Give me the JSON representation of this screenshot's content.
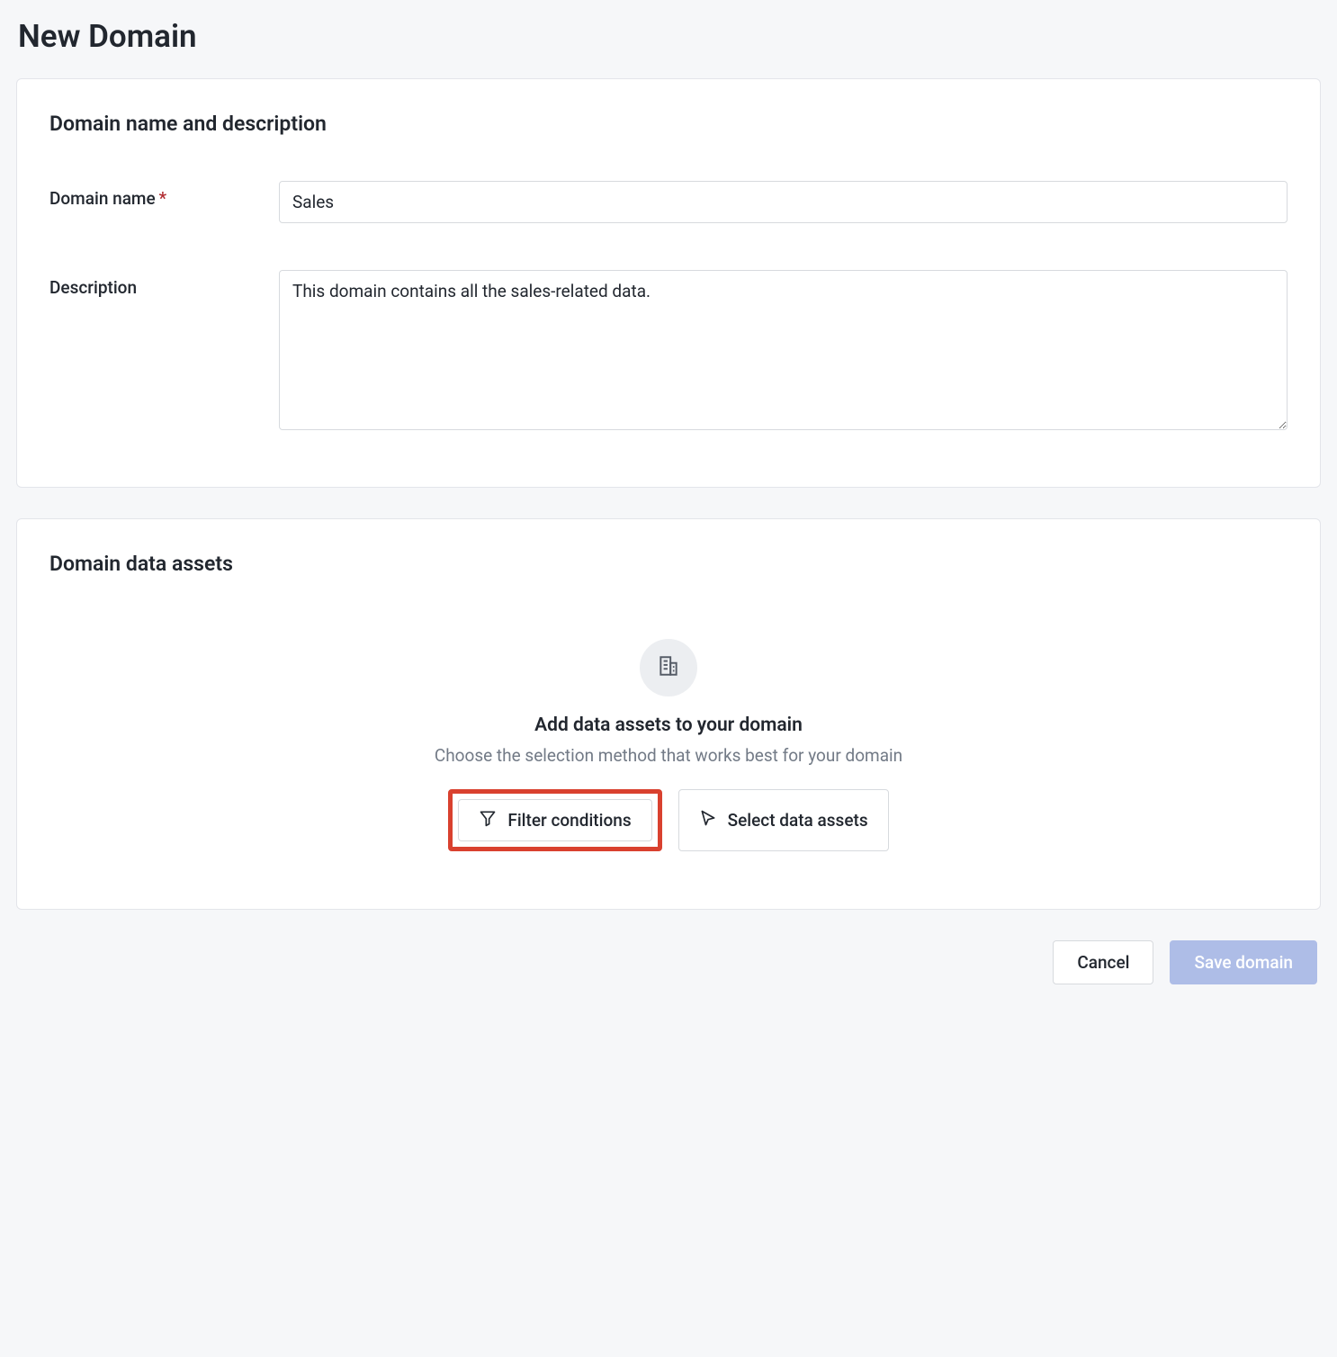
{
  "page": {
    "title": "New Domain"
  },
  "section_name_desc": {
    "heading": "Domain name and description",
    "name_label": "Domain name",
    "name_value": "Sales",
    "description_label": "Description",
    "description_value": "This domain contains all the sales-related data."
  },
  "section_assets": {
    "heading": "Domain data assets",
    "empty_title": "Add data assets to your domain",
    "empty_subtitle": "Choose the selection method that works best for your domain",
    "filter_button": "Filter conditions",
    "select_button": "Select data assets"
  },
  "actions": {
    "cancel": "Cancel",
    "save": "Save domain"
  }
}
